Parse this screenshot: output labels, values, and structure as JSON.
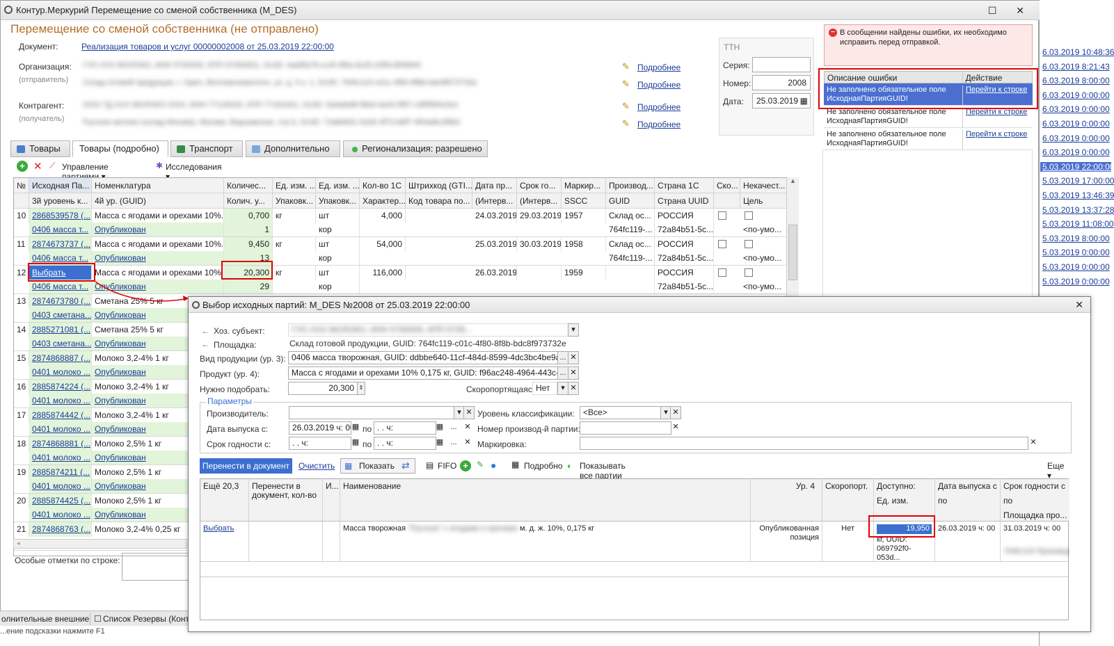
{
  "main_window": {
    "title": "Контур.Меркурий Перемещение со сменой собственника (M_DES)",
    "controls": [
      "☐",
      "✕"
    ],
    "doc_title": "Перемещение со сменой собственника (не отправлено)",
    "document_label": "Документ:",
    "document_link": "Реализация товаров и услуг 00000002008 от 25.03.2019 22:00:00",
    "org_label": "Организация:",
    "org_sub": "(отправитель)",
    "org_line1": "ГУО ХХХ МОЛОКО, ИНН 5700000, КПП 57050001, GUID: 4ad6fa7b-cc4f-4f6a-9c05-20f5c3f06840",
    "org_line2": "Склад готовой продукции, г. Орёл, Волховскомолочн. ул. д. 5 к. 1, GUID: 764fc119-c01c-4f80-8f8b-bdc8f973732e",
    "contr_label": "Контрагент:",
    "contr_sub": "(получатель)",
    "contr_line1": "ООО ТД ХХХ МОЛОКО ООО, ИНН 77125020, КПП 77181001, GUID: 5a4a8af8-fb6d-4a43-8f57-c8f5f6f4c0e1",
    "contr_line2": "Русское молоко (склад Москва), Москва, Варшавское, стр 6, GUID: 72a84b51-5cb5-4f73-b8f7-4f04a8c2f6b2",
    "more_links": [
      "Подробнее",
      "Подробнее",
      "Подробнее",
      "Подробнее"
    ],
    "ttn": {
      "label": "ТТН",
      "series_label": "Серия:",
      "series_value": "",
      "number_label": "Номер:",
      "number_value": "2008",
      "date_label": "Дата:",
      "date_value": "25.03.2019"
    },
    "error_message": "В сообщении найдены ошибки, их необходимо исправить перед отправкой.",
    "error_table": {
      "col1": "Описание ошибки",
      "col2": "Действие",
      "rows": [
        {
          "desc": "Не заполнено обязательное поле ИсходнаяПартияGUID!",
          "action": "Перейти к строке"
        },
        {
          "desc": "Не заполнено обязательное поле ИсходнаяПартияGUID!",
          "action": "Перейти к строке"
        },
        {
          "desc": "Не заполнено обязательное поле ИсходнаяПартияGUID!",
          "action": "Перейти к строке"
        }
      ]
    },
    "tabs": [
      "Товары",
      "Товары (подробно)",
      "Транспорт",
      "Дополнительно",
      "Регионализация: разрешено"
    ],
    "toolbar": {
      "manage": "Управление партиями ▾",
      "research": "Исследования ▾"
    },
    "grid_headers_1": [
      "№",
      "Исходная Па...",
      "Номенклатура",
      "Количес...",
      "Ед. изм. ...",
      "Ед. изм. ...",
      "Кол-во 1С",
      "Штрихкод (GTI...",
      "Дата пр...",
      "Срок го...",
      "Маркир...",
      "Производ...",
      "Страна 1С",
      "Ско...",
      "Некачест..."
    ],
    "grid_headers_2": [
      "",
      "3й уровень к...",
      "4й ур. (GUID)",
      "Колич. у...",
      "Упаковк...",
      "Упаковк...",
      "Характер...",
      "Код товара по...",
      "(Интерв...",
      "(Интерв...",
      "SSCC",
      "GUID",
      "Страна UUID",
      "",
      "Цель"
    ],
    "rows": [
      {
        "n": "10",
        "src": "2868539578 (...",
        "nom": "Масса с ягодами и орехами 10%...",
        "qty": "0,700",
        "u1": "кг",
        "u2": "шт",
        "q1c": "4,000",
        "bar": "",
        "d1": "24.03.2019",
        "d2": "29.03.2019",
        "mark": "1957",
        "prod": "Склад ос...",
        "country": "РОССИЯ",
        "src2": "0406 масса т...",
        "nom2": "Опубликован",
        "qty2": "1",
        "u22": "кор",
        "prod2": "764fc119-...",
        "country2": "72a84b51-5c...",
        "goal": "<по-умо..."
      },
      {
        "n": "11",
        "src": "2874673737 (...",
        "nom": "Масса с ягодами и орехами 10%...",
        "qty": "9,450",
        "u1": "кг",
        "u2": "шт",
        "q1c": "54,000",
        "bar": "",
        "d1": "25.03.2019",
        "d2": "30.03.2019",
        "mark": "1958",
        "prod": "Склад ос...",
        "country": "РОССИЯ",
        "src2": "0406 масса т...",
        "nom2": "Опубликован",
        "qty2": "13",
        "u22": "кор",
        "prod2": "764fc119-...",
        "country2": "72a84b51-5c...",
        "goal": "<по-умо..."
      },
      {
        "n": "12",
        "src": "Выбрать",
        "nom": "Масса с ягодами и орехами 10%...",
        "qty": "20,300",
        "u1": "кг",
        "u2": "шт",
        "q1c": "116,000",
        "bar": "",
        "d1": "26.03.2019",
        "d2": "",
        "mark": "1959",
        "prod": "",
        "country": "РОССИЯ",
        "src2": "0406 масса т...",
        "nom2": "Опубликован",
        "qty2": "29",
        "u22": "кор",
        "prod2": "",
        "country2": "72a84b51-5c...",
        "goal": "<по-умо..."
      },
      {
        "n": "13",
        "src": "2874673780 (...",
        "nom": "Сметана 25% 5 кг",
        "src2": "0403 сметана...",
        "nom2": "Опубликован"
      },
      {
        "n": "14",
        "src": "2885271081 (...",
        "nom": "Сметана 25% 5 кг",
        "src2": "0403 сметана...",
        "nom2": "Опубликован"
      },
      {
        "n": "15",
        "src": "2874868887 (...",
        "nom": "Молоко 3,2-4% 1 кг",
        "src2": "0401 молоко ...",
        "nom2": "Опубликован"
      },
      {
        "n": "16",
        "src": "2885874224 (...",
        "nom": "Молоко 3,2-4% 1 кг",
        "src2": "0401 молоко ...",
        "nom2": "Опубликован"
      },
      {
        "n": "17",
        "src": "2885874442 (...",
        "nom": "Молоко 3,2-4% 1 кг",
        "src2": "0401 молоко ...",
        "nom2": "Опубликован"
      },
      {
        "n": "18",
        "src": "2874868881 (...",
        "nom": "Молоко 2,5% 1 кг",
        "src2": "0401 молоко ...",
        "nom2": "Опубликован"
      },
      {
        "n": "19",
        "src": "2885874211 (...",
        "nom": "Молоко 2,5% 1 кг",
        "src2": "0401 молоко ...",
        "nom2": "Опубликован"
      },
      {
        "n": "20",
        "src": "2885874425 (...",
        "nom": "Молоко 2,5% 1 кг",
        "src2": "0401 молоко ...",
        "nom2": "Опубликован"
      },
      {
        "n": "21",
        "src": "2874868763 (...",
        "nom": "Молоко 3,2-4% 0,25 кг"
      }
    ],
    "note_label": "Особые отметки по строке:",
    "taskbar": [
      "олнительные внешние ...",
      "Список Резервы (Контур"
    ],
    "status_text": "...ение подсказки нажмите F1"
  },
  "right_strip_dates": [
    "6.03.2019 10:48:36",
    "6.03.2019 8:21:43",
    "6.03.2019 8:00:00",
    "6.03.2019 0:00:00",
    "6.03.2019 0:00:00",
    "6.03.2019 0:00:00",
    "6.03.2019 0:00:00",
    "6.03.2019 0:00:00",
    "5.03.2019 22:00:00",
    "5.03.2019 17:00:00",
    "5.03.2019 13:46:39",
    "5.03.2019 13:37:28",
    "5.03.2019 11:08:00",
    "5.03.2019 8:00:00",
    "5.03.2019 0:00:00",
    "5.03.2019 0:00:00",
    "5.03.2019 0:00:00"
  ],
  "popup": {
    "title": "Выбор исходных партий: M_DES №2008 от 25.03.2019 22:00:00",
    "hoz_label": "Хоз. субъект:",
    "hoz_value": "ГУО ХХХ МОЛОКО, ИНН 5700000, КПП 5705...",
    "site_label": "Площадка:",
    "site_value": "Склад готовой продукции, GUID: 764fc119-c01c-4f80-8f8b-bdc8f973732e",
    "kind_label": "Вид продукции (ур. 3):",
    "kind_value": "0406 масса творожная, GUID: ddbbe640-11cf-484d-8599-4dc3bc4be9a9",
    "product_label": "Продукт (ур. 4):",
    "product_value": "Масса с ягодами и орехами 10% 0,175 кг, GUID: f96ac248-4964-443c-9228-01...",
    "need_label": "Нужно подобрать:",
    "need_value": "20,300",
    "perish_label": "Скоропортящаяся:",
    "perish_value": "Нет",
    "params_title": "Параметры",
    "maker_label": "Производитель:",
    "release_label": "Дата выпуска с:",
    "release_from": "26.03.2019  ч: 00",
    "release_to": " .  .     ч:",
    "po": "по",
    "expiry_label": "Срок годности с:",
    "expiry_from": " .  .     ч:",
    "expiry_to": " .  .     ч:",
    "class_label": "Уровень классификации:",
    "class_value": "<Все>",
    "batch_label": "Номер производ-й партии:",
    "mark_label": "Маркировка:",
    "btn_move": "Перенести в документ",
    "btn_clear": "Очистить",
    "btn_show": "Показать",
    "fifo": "FIFO",
    "detail": "Подробно",
    "show_all": "Показывать все партии",
    "more": "Еще ▾",
    "headers": {
      "h1": "Ещё 20,3",
      "h2": "Перенести в документ, кол-во",
      "h3": "И...",
      "h4": "Наименование",
      "h5": "Ур. 4",
      "h6": "Скоропорт.",
      "h7": "Доступно:",
      "h7b": "Ед. изм.",
      "h8": "Дата выпуска с",
      "h8b": "по",
      "h9": "Срок годности с",
      "h9b": "по",
      "h9c": "Площадка про..."
    },
    "row": {
      "select": "Выбрать",
      "name_a": "Масса творожная",
      "name_blur": "\"Русское\" с ягодами и орехами",
      "name_b": "м. д. ж. 10%, 0,175 кг",
      "level": "Опубликованная позиция",
      "perish": "Нет",
      "avail": "19,950",
      "unit": "кг, UUID: 069792f0-053d...",
      "rel_from": "26.03.2019",
      "rel_h": "ч: 00",
      "exp": "31.03.2019",
      "exp_h": "ч: 00",
      "site_blur": "764fc119 Производств..."
    }
  },
  "colors": {
    "accent": "#3c6fcf",
    "error": "#e00000",
    "green_cell": "#e2f4da",
    "title_orange": "#b56d2a"
  }
}
